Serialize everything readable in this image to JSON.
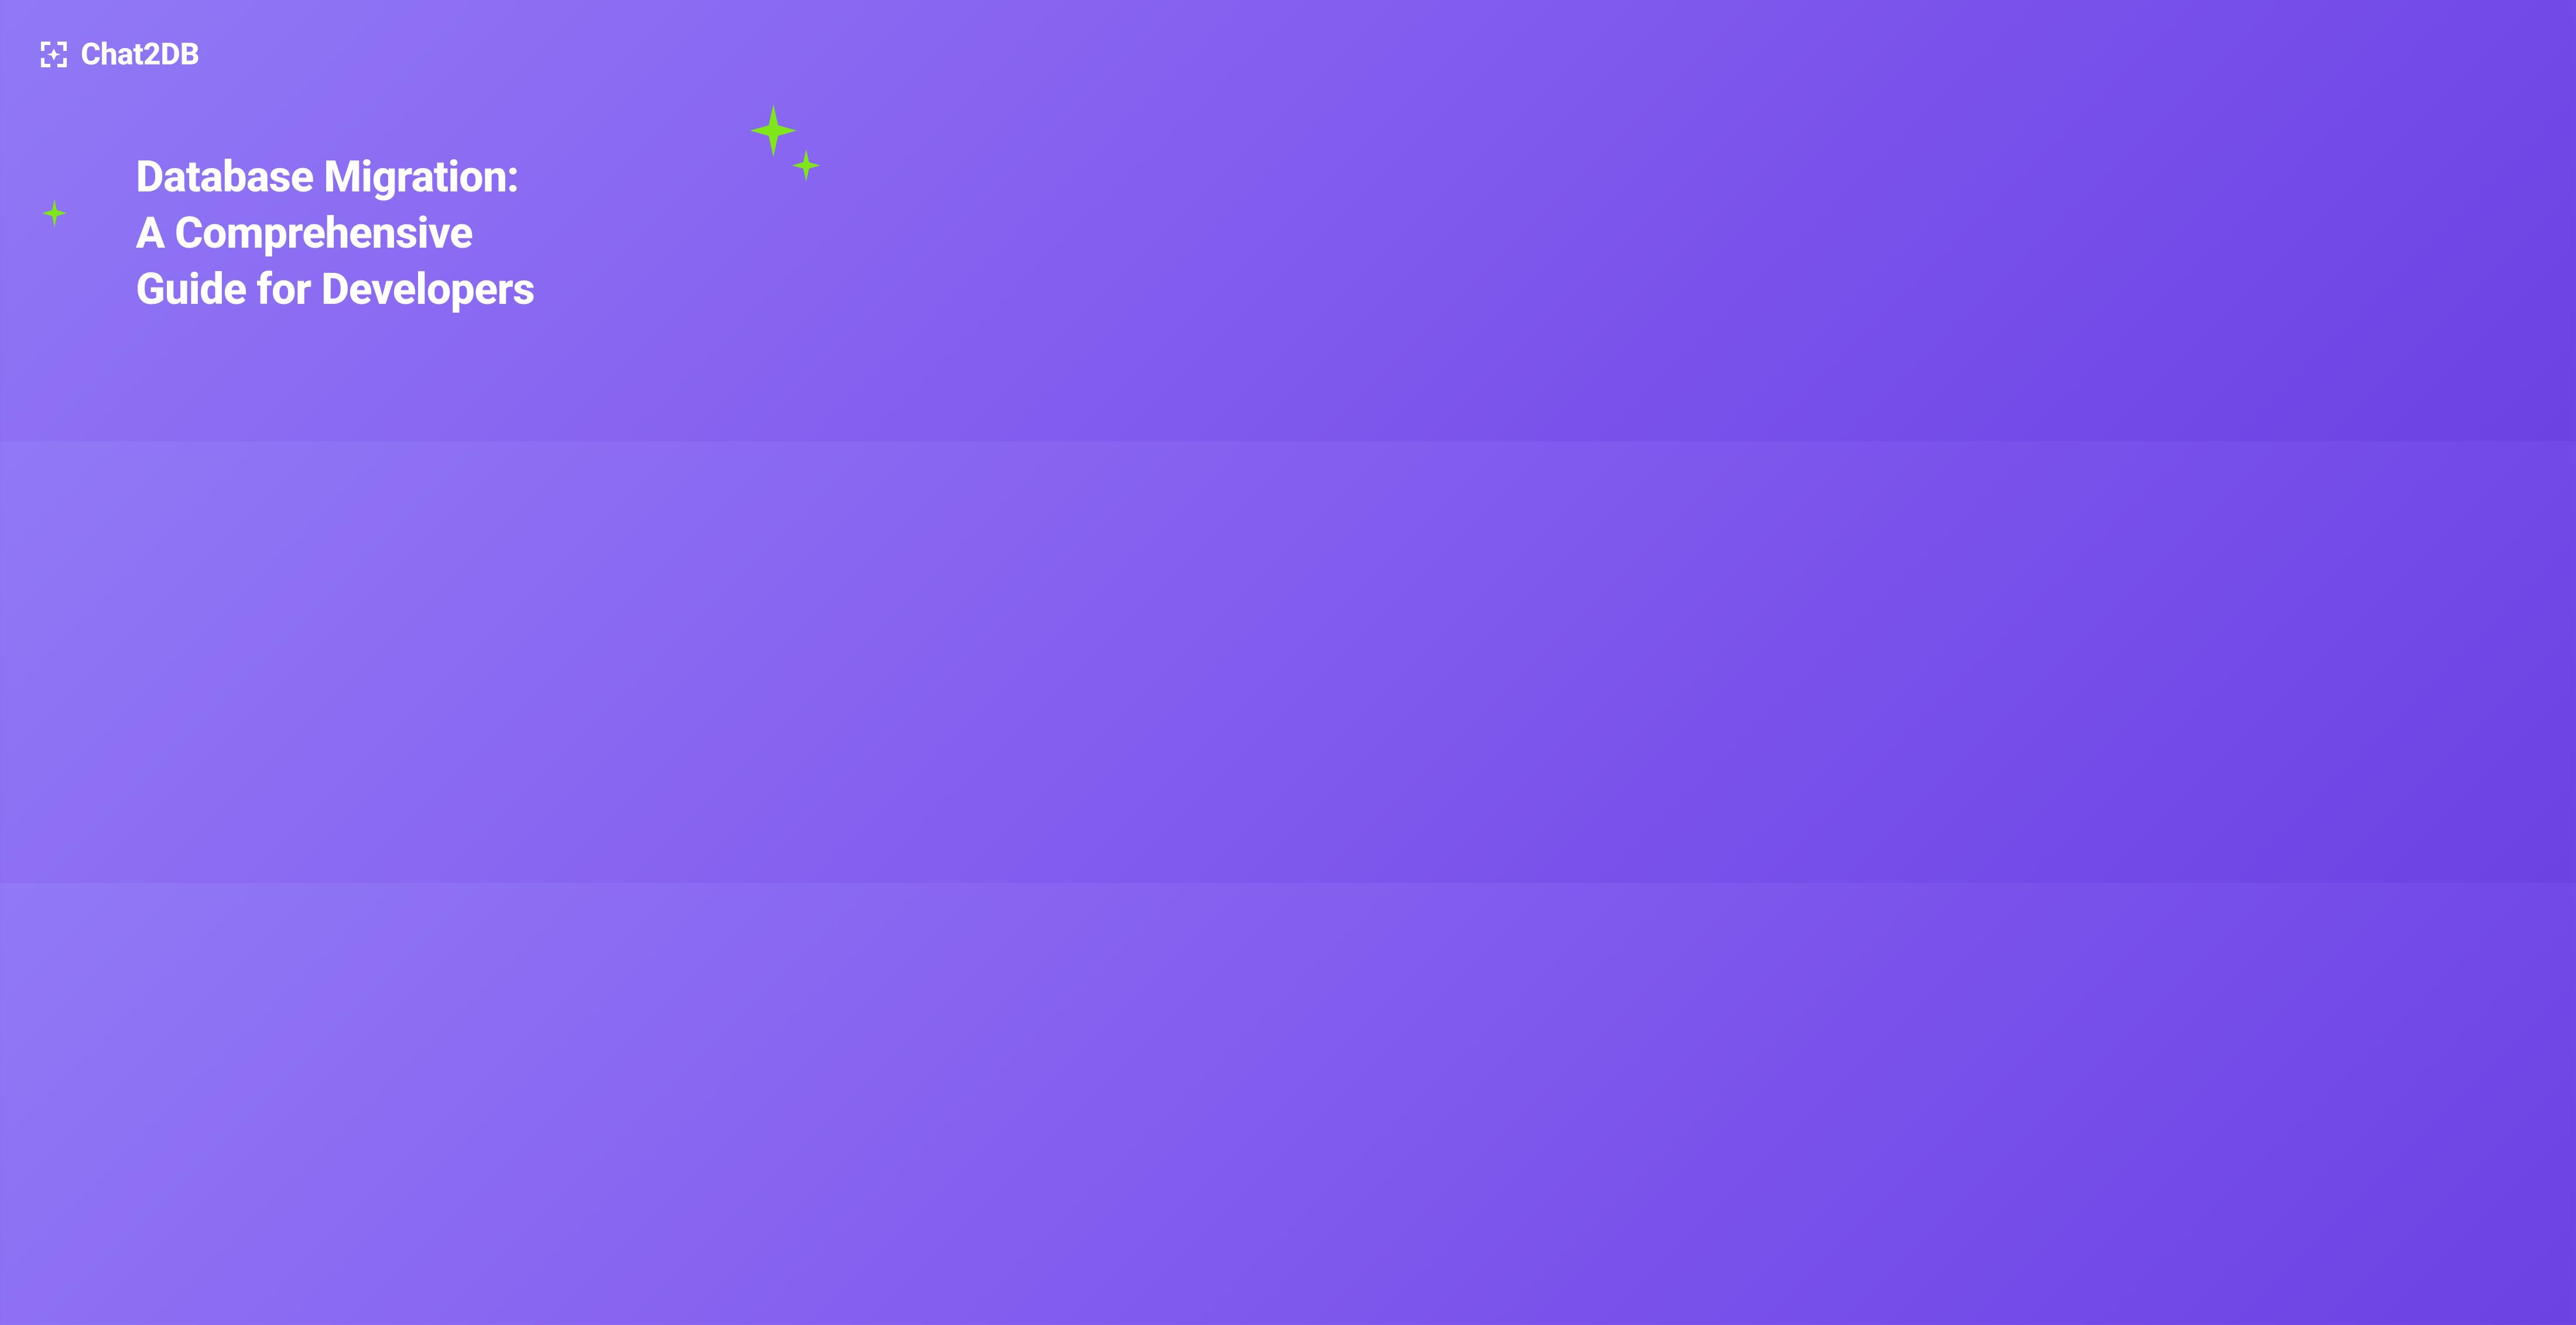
{
  "logo": {
    "text": "Chat2DB"
  },
  "title": {
    "line1": "Database Migration:",
    "line2": "A Comprehensive",
    "line3": "Guide for Developers"
  },
  "colors": {
    "sparkle": "#7fe619",
    "text": "#ffffff"
  }
}
